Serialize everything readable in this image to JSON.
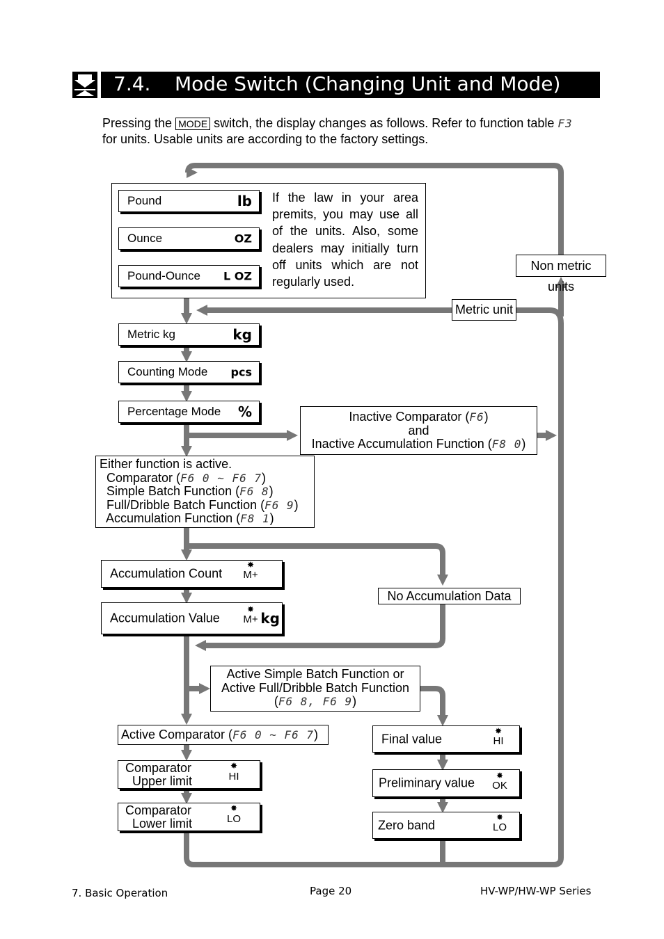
{
  "header": {
    "number": "7.4.",
    "title": "Mode Switch (Changing Unit and Mode)",
    "icon": "scale-arrow-icon"
  },
  "intro": {
    "line1_a": "Pressing the",
    "key": "MODE",
    "line1_b": "switch, the display changes as follows. Refer to function table",
    "fn": "F3",
    "line2": "for units. Usable units are according to the factory settings."
  },
  "colors": {
    "arrow": "#777777",
    "header_bg": "#000000"
  },
  "non_metric": {
    "items": [
      {
        "label": "Pound",
        "unit": "lb"
      },
      {
        "label": "Ounce",
        "unit": "OZ"
      },
      {
        "label": "Pound-Ounce",
        "unit": "L OZ"
      }
    ],
    "note": "If the law in your area premits, you may use all of the units. Also, some dealers may initially turn off units which are not regularly used.",
    "tag": "Non metric units"
  },
  "metric_tag": "Metric unit",
  "modes": [
    {
      "label": "Metric kg",
      "unit": "kg"
    },
    {
      "label": "Counting Mode",
      "unit": "pcs"
    },
    {
      "label": "Percentage Mode",
      "unit": "%"
    }
  ],
  "inactive": {
    "l1a": "Inactive Comparator (",
    "l1code": "F6",
    "l1b": ")",
    "l2": "and",
    "l3a": "Inactive Accumulation Function (",
    "l3code": "F8 0",
    "l3b": ")"
  },
  "either": {
    "title": "Either function is active.",
    "rows": [
      {
        "a": "Comparator (",
        "code": "F6 0 ~ F6 7",
        "b": ")"
      },
      {
        "a": "Simple Batch Function (",
        "code": "F6 8",
        "b": ")"
      },
      {
        "a": "Full/Dribble Batch Function (",
        "code": "F6 9",
        "b": ")"
      },
      {
        "a": "Accumulation Function (",
        "code": "F8 1",
        "b": ")"
      }
    ]
  },
  "accum": {
    "count": "Accumulation Count",
    "value": "Accumulation Value",
    "ind": "M+",
    "unit": "kg",
    "none": "No Accumulation Data"
  },
  "batch": {
    "l1": "Active Simple Batch Function  or",
    "l2": "Active Full/Dribble Batch Function",
    "l3a": "(",
    "l3code": "F6 8, F6 9",
    "l3b": ")"
  },
  "comparator": {
    "a": "Active Comparator (",
    "code": "F6 0 ~ F6 7",
    "b": ")",
    "upper1": "Comparator",
    "upper2": "Upper limit",
    "upper_ind": "HI",
    "lower1": "Comparator",
    "lower2": "Lower limit",
    "lower_ind": "LO"
  },
  "batch_steps": [
    {
      "label": "Final value",
      "ind": "HI"
    },
    {
      "label": "Preliminary value",
      "ind": "OK"
    },
    {
      "label": "Zero band",
      "ind": "LO"
    }
  ],
  "footer": {
    "section": "7. Basic Operation",
    "page": "Page 20",
    "series": "HV-WP/HW-WP Series"
  }
}
